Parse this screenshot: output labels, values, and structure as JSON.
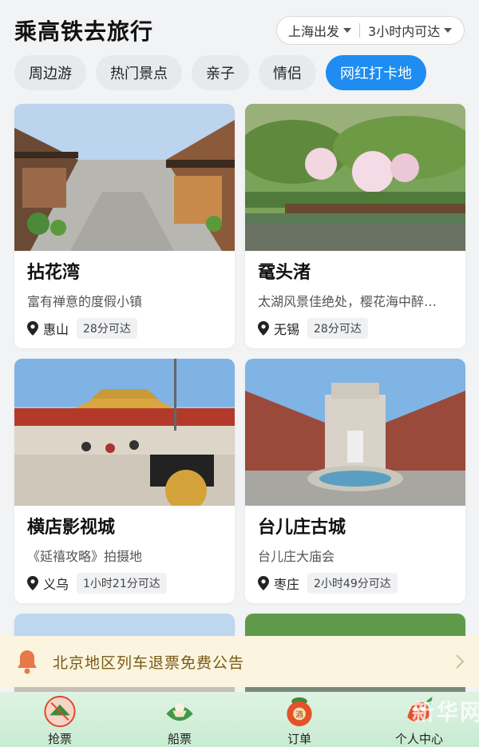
{
  "header": {
    "title": "乘高铁去旅行",
    "departure": "上海出发",
    "range": "3小时内可达"
  },
  "tabs": [
    {
      "label": "周边游",
      "active": false
    },
    {
      "label": "热门景点",
      "active": false
    },
    {
      "label": "亲子",
      "active": false
    },
    {
      "label": "情侣",
      "active": false
    },
    {
      "label": "网红打卡地",
      "active": true
    }
  ],
  "cards": [
    {
      "name": "拈花湾",
      "desc": "富有禅意的度假小镇",
      "city": "惠山",
      "reach": "28分可达"
    },
    {
      "name": "鼋头渚",
      "desc": "太湖风景佳绝处，樱花海中醉…",
      "city": "无锡",
      "reach": "28分可达"
    },
    {
      "name": "横店影视城",
      "desc": "《延禧攻略》拍摄地",
      "city": "义乌",
      "reach": "1小时21分可达"
    },
    {
      "name": "台儿庄古城",
      "desc": "台儿庄大庙会",
      "city": "枣庄",
      "reach": "2小时49分可达"
    }
  ],
  "notice": {
    "text": "北京地区列车退票免费公告"
  },
  "bottom_nav": [
    {
      "label": "抢票",
      "icon": "ticket-grab-icon"
    },
    {
      "label": "船票",
      "icon": "ferry-ticket-icon"
    },
    {
      "label": "订单",
      "icon": "orders-icon"
    },
    {
      "label": "个人中心",
      "icon": "profile-icon"
    }
  ],
  "colors": {
    "accent": "#1e8cf0",
    "notice_bg": "#fbf5df",
    "notice_text": "#7a5a17",
    "nav_bg": "#d6efdb"
  },
  "watermark": "新华网"
}
